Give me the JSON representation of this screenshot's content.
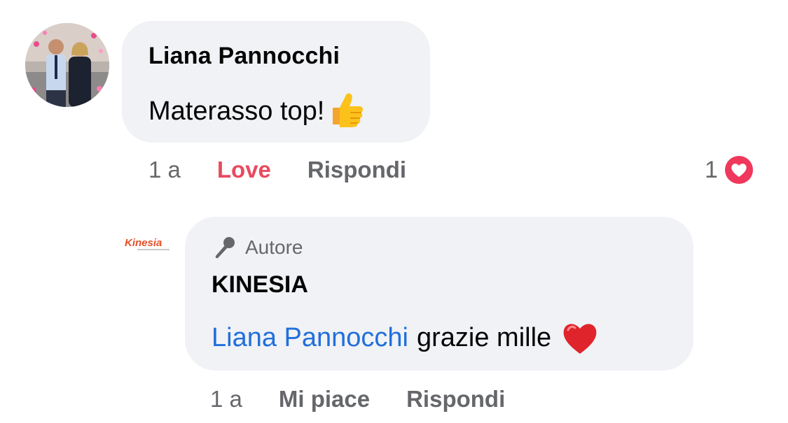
{
  "comment": {
    "author": "Liana Pannocchi",
    "text": "Materasso top!",
    "emoji": "thumbs-up",
    "time": "1 a",
    "love_label": "Love",
    "reply_label": "Rispondi",
    "reaction_count": "1",
    "reaction_type": "love"
  },
  "reply": {
    "page_logo_text": "Kinesia",
    "badge_label": "Autore",
    "badge_icon": "microphone-icon",
    "author": "KINESIA",
    "mention": "Liana Pannocchi",
    "text": "grazie mille",
    "emoji": "red-heart",
    "time": "1 a",
    "like_label": "Mi piace",
    "reply_label": "Rispondi"
  },
  "colors": {
    "bubble": "#f0f2f5",
    "love": "#e84a5f",
    "mention": "#216fdb",
    "meta": "#65676b"
  }
}
